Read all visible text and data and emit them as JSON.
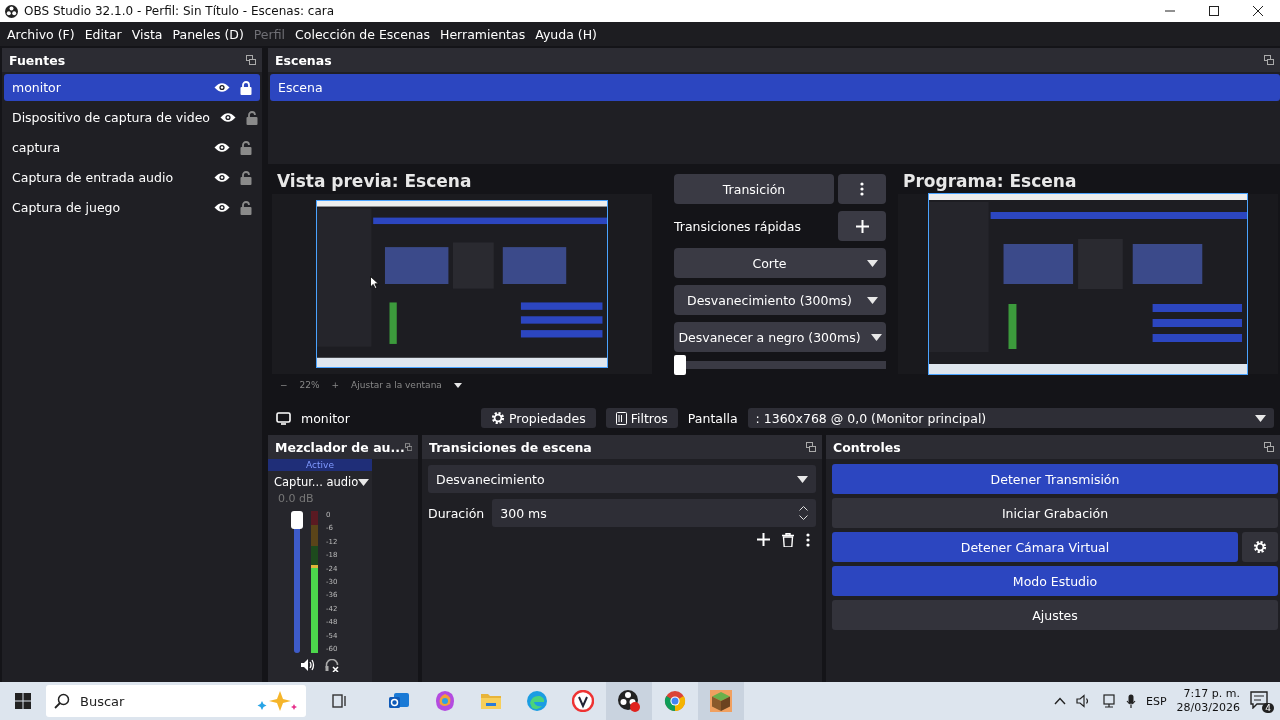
{
  "window": {
    "title": "OBS Studio 32.1.0 - Perfil: Sin Título - Escenas: cara"
  },
  "menu": [
    {
      "label": "Archivo (F)",
      "disabled": false
    },
    {
      "label": "Editar",
      "disabled": false
    },
    {
      "label": "Vista",
      "disabled": false
    },
    {
      "label": "Paneles (D)",
      "disabled": false
    },
    {
      "label": "Perfil",
      "disabled": true
    },
    {
      "label": "Colección de Escenas",
      "disabled": false
    },
    {
      "label": "Herramientas",
      "disabled": false
    },
    {
      "label": "Ayuda (H)",
      "disabled": false
    }
  ],
  "sources": {
    "title": "Fuentes",
    "items": [
      {
        "name": "monitor",
        "visible": true,
        "locked": true,
        "selected": true
      },
      {
        "name": "Dispositivo de captura de video",
        "visible": true,
        "locked": false,
        "selected": false
      },
      {
        "name": "captura",
        "visible": true,
        "locked": false,
        "selected": false
      },
      {
        "name": "Captura de entrada audio",
        "visible": true,
        "locked": false,
        "selected": false
      },
      {
        "name": "Captura de juego",
        "visible": true,
        "locked": false,
        "selected": false
      }
    ]
  },
  "scenes": {
    "title": "Escenas",
    "items": [
      {
        "name": "Escena",
        "selected": true
      }
    ]
  },
  "preview": {
    "title": "Vista previa: Escena",
    "zoom_minus": "−",
    "zoom": "22%",
    "zoom_plus": "+",
    "fit": "Ajustar a la ventana"
  },
  "transition_panel": {
    "transition_button": "Transición",
    "quick_label": "Transiciones rápidas",
    "quick": [
      {
        "label": "Corte"
      },
      {
        "label": "Desvanecimiento (300ms)"
      },
      {
        "label": "Desvanecer a negro (300ms)"
      }
    ],
    "slider": {
      "level": 0
    }
  },
  "program": {
    "title": "Programa: Escena"
  },
  "source_toolbar": {
    "source": "monitor",
    "properties": "Propiedades",
    "filters": "Filtros",
    "display_label": "Pantalla",
    "display_value": ": 1360x768 @ 0,0 (Monitor principal)"
  },
  "mixer": {
    "title": "Mezclador de au...",
    "status": "Active",
    "channel": "Captur... audio",
    "reading": "0.0 dB",
    "volume": {
      "level": 1
    },
    "meter": {
      "level": 0.62
    },
    "ticks": [
      "0",
      "-6",
      "-12",
      "-18",
      "-24",
      "-30",
      "-36",
      "-42",
      "-48",
      "-54",
      "-60"
    ]
  },
  "scene_transitions": {
    "title": "Transiciones de escena",
    "type": "Desvanecimiento",
    "duration_label": "Duración",
    "duration": "300 ms"
  },
  "controls": {
    "title": "Controles",
    "buttons": [
      {
        "label": "Detener Transmisión",
        "active": true,
        "settings": false
      },
      {
        "label": "Iniciar Grabación",
        "active": false,
        "settings": false
      },
      {
        "label": "Detener Cámara Virtual",
        "active": true,
        "settings": true
      },
      {
        "label": "Modo Estudio",
        "active": true,
        "settings": false
      },
      {
        "label": "Ajustes",
        "active": false,
        "settings": false
      }
    ]
  },
  "taskbar": {
    "search": "Buscar",
    "apps": [
      {
        "kind": "mail",
        "selected": false
      },
      {
        "kind": "assistant",
        "selected": false
      },
      {
        "kind": "folder",
        "selected": false
      },
      {
        "kind": "browser",
        "selected": false
      },
      {
        "kind": "shield",
        "selected": false
      },
      {
        "kind": "recorder",
        "selected": true
      },
      {
        "kind": "chrome",
        "selected": false
      },
      {
        "kind": "block",
        "selected": true
      }
    ],
    "language": "ESP",
    "time": "7:17 p. m.",
    "date": "28/03/2026",
    "notifications": "4"
  }
}
